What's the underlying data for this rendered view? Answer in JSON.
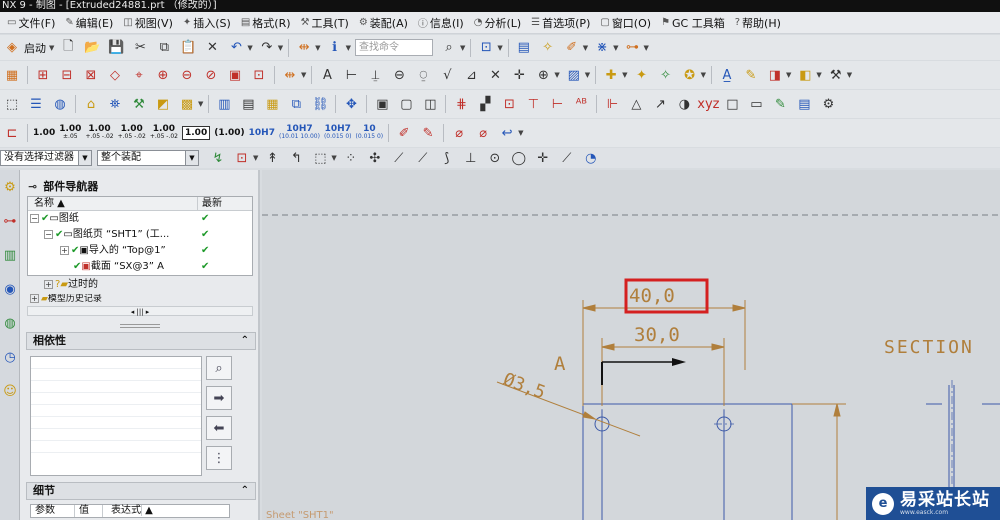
{
  "window": {
    "title": "NX 9 - 制图 - [Extruded24881.prt （修改的）]"
  },
  "menubar": {
    "items": [
      {
        "label": "文件(F)",
        "icon": "file-icon"
      },
      {
        "label": "编辑(E)",
        "icon": "edit-icon"
      },
      {
        "label": "视图(V)",
        "icon": "view-icon"
      },
      {
        "label": "插入(S)",
        "icon": "insert-icon"
      },
      {
        "label": "格式(R)",
        "icon": "format-icon"
      },
      {
        "label": "工具(T)",
        "icon": "tools-icon"
      },
      {
        "label": "装配(A)",
        "icon": "assembly-icon"
      },
      {
        "label": "信息(I)",
        "icon": "info-icon"
      },
      {
        "label": "分析(L)",
        "icon": "analysis-icon"
      },
      {
        "label": "首选项(P)",
        "icon": "preferences-icon"
      },
      {
        "label": "窗口(O)",
        "icon": "window-icon"
      },
      {
        "label": "GC 工具箱",
        "icon": "gc-toolbox-icon"
      },
      {
        "label": "帮助(H)",
        "icon": "help-icon"
      }
    ]
  },
  "toolbar": {
    "start_label": "启动",
    "command_search_placeholder": "查找命令"
  },
  "tolerance_toolbar": {
    "items": [
      {
        "main": "1.00",
        "sub": ""
      },
      {
        "main": "1.00",
        "sub": "±.05"
      },
      {
        "main": "1.00",
        "sub": "+.05 -.02"
      },
      {
        "main": "1.00",
        "sub": "+.05 -.02"
      },
      {
        "main": "1.00",
        "sub": "+.05 -.02"
      },
      {
        "main": "1.00",
        "sub": "boxed"
      },
      {
        "main": "(1.00)",
        "sub": ""
      },
      {
        "main": "10H7",
        "sub": ""
      },
      {
        "main": "10H7",
        "sub": "(10.01 10.00)"
      },
      {
        "main": "10H7",
        "sub": "(0.015 0)"
      },
      {
        "main": "10",
        "sub": "(0.015 0)"
      }
    ]
  },
  "selection_bar": {
    "filter_value": "没有选择过滤器",
    "scope_value": "整个装配"
  },
  "part_navigator": {
    "title": "部件导航器",
    "col_name": "名称",
    "col_latest": "最新",
    "rows": [
      {
        "label": "图纸",
        "status": "✔"
      },
      {
        "label": "图纸页 “SHT1” (工...",
        "status": "✔"
      },
      {
        "label": "导入的 “Top@1”",
        "status": "✔"
      },
      {
        "label": "截面 “SX@3” A",
        "status": "✔"
      },
      {
        "label": "过时的",
        "status": ""
      },
      {
        "label": "模型历史记录",
        "status": ""
      }
    ]
  },
  "dependency_panel": {
    "title": "相依性"
  },
  "details_panel": {
    "title": "细节",
    "col_param": "参数",
    "col_value": "值",
    "col_expr": "表达式"
  },
  "drawing": {
    "dim_outer": "40,0",
    "dim_inner": "30,0",
    "dim_diameter": "Ø3,5",
    "section_label": "A",
    "section_title": "SECTION",
    "sheet_label": "Sheet \"SHT1\"",
    "highlight_color": "#d42020",
    "dim_color": "#b07f3c",
    "geometry_color": "#3d5aa8"
  },
  "watermark": {
    "name": "易采站长站",
    "sub": "www.easck.com"
  }
}
